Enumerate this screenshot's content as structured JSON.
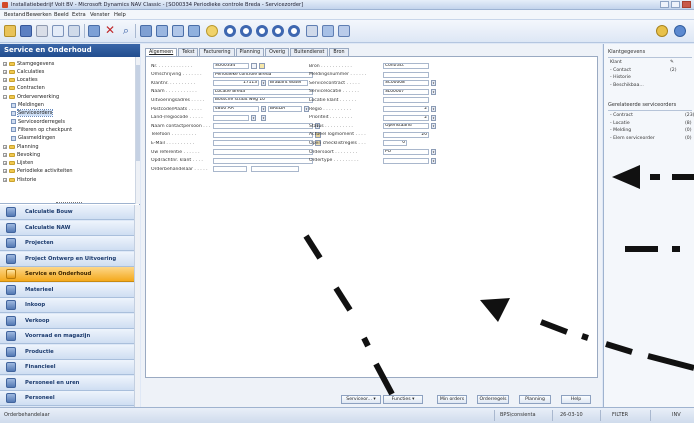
{
  "window": {
    "title": "Installatiebedrijf Volt BV - Microsoft Dynamics NAV Classic - [SO00334 Periodieke controle Breda - Servicezorder]"
  },
  "menu": [
    "Bestand",
    "Bewerken",
    "Beeld",
    "Extra",
    "Venster",
    "Help"
  ],
  "toolbar": {
    "icons": [
      "open-icon",
      "save-icon",
      "print-icon",
      "copy-icon",
      "paste-icon",
      "filter-icon",
      "delete-icon",
      "find-icon",
      "table-icon",
      "list-icon",
      "card-icon",
      "calendar-icon",
      "help-icon",
      "circle-icon",
      "circle-icon",
      "circle-icon",
      "circle-icon",
      "circle-icon",
      "report-icon",
      "report-icon",
      "report-icon"
    ]
  },
  "nav": {
    "header": "Service en Onderhoud",
    "tree": [
      {
        "label": "Stamgegevens",
        "level": 0,
        "type": "folder"
      },
      {
        "label": "Calculaties",
        "level": 0,
        "type": "folder"
      },
      {
        "label": "Locaties",
        "level": 0,
        "type": "folder"
      },
      {
        "label": "Contracten",
        "level": 0,
        "type": "folder"
      },
      {
        "label": "Orderverwerking",
        "level": 0,
        "type": "folder"
      },
      {
        "label": "Meldingen",
        "level": 1,
        "type": "page"
      },
      {
        "label": "Serviceorders",
        "level": 1,
        "type": "page",
        "selected": true
      },
      {
        "label": "Serviceorderregels",
        "level": 1,
        "type": "page"
      },
      {
        "label": "Filteren op checkpunt",
        "level": 1,
        "type": "page"
      },
      {
        "label": "Glasmeldingen",
        "level": 1,
        "type": "page"
      },
      {
        "label": "Planning",
        "level": 0,
        "type": "folder"
      },
      {
        "label": "Bevoking",
        "level": 0,
        "type": "folder"
      },
      {
        "label": "Lijsten",
        "level": 0,
        "type": "folder"
      },
      {
        "label": "Periodieke activiteiten",
        "level": 0,
        "type": "folder"
      },
      {
        "label": "Historie",
        "level": 0,
        "type": "folder"
      }
    ],
    "modules": [
      {
        "label": "Calculatie Bouw",
        "active": false
      },
      {
        "label": "Calculatie NAW",
        "active": false
      },
      {
        "label": "Projecten",
        "active": false
      },
      {
        "label": "Project Ontwerp en Uitvoering",
        "active": false
      },
      {
        "label": "Service en Onderhoud",
        "active": true
      },
      {
        "label": "Materieel",
        "active": false
      },
      {
        "label": "Inkoop",
        "active": false
      },
      {
        "label": "Verkoop",
        "active": false
      },
      {
        "label": "Voorraad en magazijn",
        "active": false
      },
      {
        "label": "Productie",
        "active": false
      },
      {
        "label": "Financieel",
        "active": false
      },
      {
        "label": "Personeel en uren",
        "active": false
      },
      {
        "label": "Personeel",
        "active": false
      }
    ]
  },
  "card": {
    "tabs": [
      {
        "label": "Algemeen",
        "active": true
      },
      {
        "label": "Tekst",
        "active": false
      },
      {
        "label": "Facturering",
        "active": false
      },
      {
        "label": "Planning",
        "active": false
      },
      {
        "label": "Overig",
        "active": false
      },
      {
        "label": "Buitendienst",
        "active": false
      },
      {
        "label": "Bron",
        "active": false
      }
    ],
    "left_fields": [
      {
        "label": "Nr. . . . . . . . . . . . .",
        "value": "SO00334",
        "extra": "",
        "icons": "edit"
      },
      {
        "label": "Omschrijving . . . . . . .",
        "value": "Periodieke controle Breda",
        "extra": "",
        "icons": ""
      },
      {
        "label": "Klantnr. . . . . . . . . .",
        "value": "17113",
        "extra": "Brabant Water",
        "icons": "dd"
      },
      {
        "label": "Naam . . . . . . . . . . .",
        "value": "Locatie Breda",
        "extra": "",
        "icons": ""
      },
      {
        "label": "Uitvoeringsadres . . . . .",
        "value": "Bossche straat weg 10",
        "extra": "",
        "icons": ""
      },
      {
        "label": "Postcode/Plaats . . . . .",
        "value": "4800 AA",
        "extra": "BREDA",
        "icons": "dd2"
      },
      {
        "label": "Land-/regiocode . . . . .",
        "value": "",
        "extra": "",
        "icons": "dd3"
      },
      {
        "label": "Naam contactpersoon . . .",
        "value": "",
        "extra": "",
        "icons": "dd"
      },
      {
        "label": "Telefoon . . . . . . . . .",
        "value": "",
        "extra": "",
        "icons": "phone"
      },
      {
        "label": "E-Mail . . . . . . . . . .",
        "value": "",
        "extra": "",
        "icons": "mail"
      },
      {
        "label": "Uw referentie . . . . . .",
        "value": "",
        "extra": "",
        "icons": ""
      },
      {
        "label": "Opdrachtnr. klant . . . .",
        "value": "",
        "extra": "",
        "icons": ""
      },
      {
        "label": "Orderbehandelaar . . . . .",
        "value": "",
        "extra": "",
        "icons": ""
      }
    ],
    "right_fields": [
      {
        "label": "Bron . . . . . . . . . . .",
        "value": "Contract",
        "icons": ""
      },
      {
        "label": "Meldingsnummer . . . . . .",
        "value": "",
        "icons": ""
      },
      {
        "label": "Servicecontract . . . . .",
        "value": "SC00008",
        "icons": "dd"
      },
      {
        "label": "Servicelocatie . . . . . .",
        "value": "SL00007",
        "icons": "dd2"
      },
      {
        "label": "Locatie klant . . . . . .",
        "value": "",
        "icons": ""
      },
      {
        "label": "Regio . . . . . . . . . .",
        "value": "2",
        "icons": "dd",
        "right": true
      },
      {
        "label": "Prioriteit . . . . . . . .",
        "value": "2",
        "icons": "dd",
        "right": true
      },
      {
        "label": "Status . . . . . . . . . .",
        "value": "Openstaand",
        "icons": "dd"
      },
      {
        "label": "Actueel logmoment . . . .",
        "value": "20",
        "icons": "",
        "right": true
      },
      {
        "label": "Open checklistregels . . .",
        "value": "0",
        "icons": "",
        "right": true,
        "short": true
      },
      {
        "label": "Ordersoort . . . . . . . .",
        "value": "PO",
        "icons": "dd"
      },
      {
        "label": "Ordertype . . . . . . . . .",
        "value": "",
        "icons": "dd"
      }
    ],
    "buttons": [
      "Serviceor...",
      "Functies",
      "Min orders",
      "Orderregels",
      "Planning",
      "Help"
    ]
  },
  "factbox": {
    "klant_title": "Klantgegevens",
    "klant_rows": [
      {
        "label": "Klant",
        "value": ""
      },
      {
        "label": "- Contact",
        "value": "(2)"
      },
      {
        "label": "- Historie",
        "value": ""
      },
      {
        "label": "- Beschikbaa...",
        "value": ""
      }
    ],
    "orders_title": "Gerelateerde serviceorders",
    "orders_rows": [
      {
        "label": "- Contract",
        "value": "(23)"
      },
      {
        "label": "- Locatie",
        "value": "(8)"
      },
      {
        "label": "- Melding",
        "value": "(0)"
      },
      {
        "label": "- Elem serviceorder",
        "value": "(0)"
      }
    ]
  },
  "status": {
    "left": "Orderbehandelaar",
    "user": "BPS\\consienta",
    "date": "26-03-10",
    "filter": "FILTER",
    "mode": "INV"
  },
  "colors": {
    "nav_header": "#224d8e",
    "active_module": "#f4a91c",
    "arrow": "#111111"
  }
}
